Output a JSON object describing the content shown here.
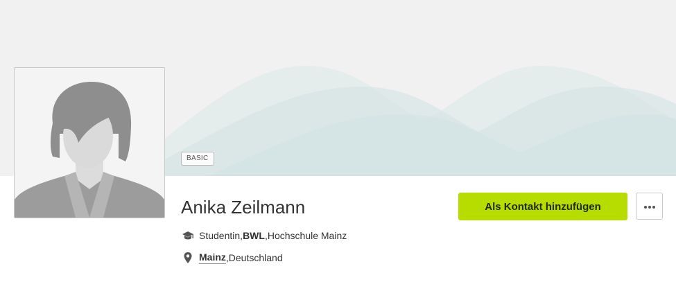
{
  "profile": {
    "membership_badge": "BASIC",
    "name": "Anika Zeilmann",
    "education": {
      "icon": "graduation-cap-icon",
      "role": "Studentin",
      "separator1": ", ",
      "field": "BWL",
      "separator2": ", ",
      "institution": "Hochschule Mainz"
    },
    "location": {
      "icon": "location-pin-icon",
      "city": "Mainz",
      "separator": ", ",
      "country": "Deutschland"
    }
  },
  "actions": {
    "add_contact_label": "Als Kontakt hinzufügen",
    "more_icon": "more-dots-icon"
  },
  "colors": {
    "accent": "#b7dd00",
    "banner_background": "#f1f1f1",
    "banner_wave": "#d6e6e6"
  }
}
